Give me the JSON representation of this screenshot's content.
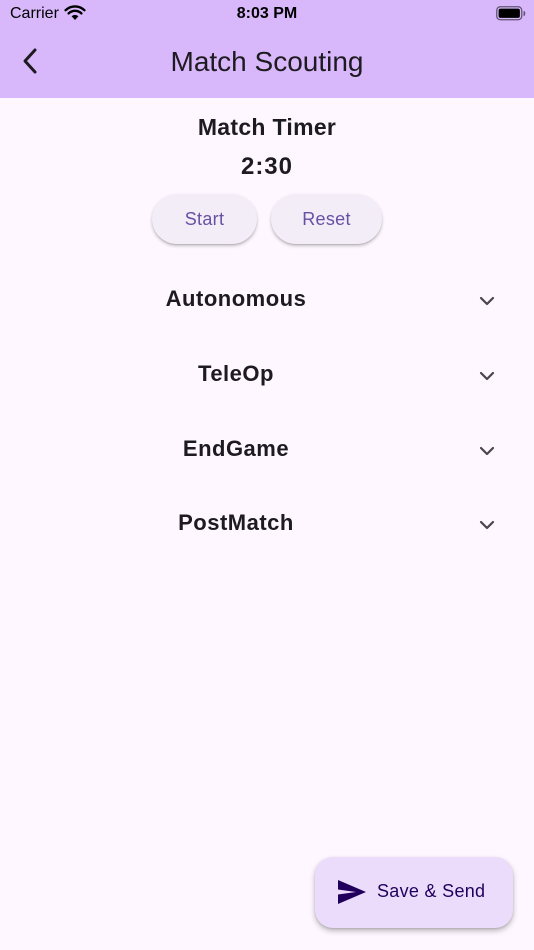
{
  "status_bar": {
    "carrier": "Carrier",
    "time": "8:03 PM",
    "wifi_icon": "wifi-icon",
    "battery_icon": "battery-icon"
  },
  "app_bar": {
    "title": "Match Scouting",
    "back_icon": "chevron-left-icon",
    "background": "#d8b8fb"
  },
  "timer": {
    "label": "Match Timer",
    "value": "2:30",
    "start_label": "Start",
    "reset_label": "Reset"
  },
  "sections": [
    {
      "label": "Autonomous",
      "icon": "chevron-down-icon"
    },
    {
      "label": "TeleOp",
      "icon": "chevron-down-icon"
    },
    {
      "label": "EndGame",
      "icon": "chevron-down-icon"
    },
    {
      "label": "PostMatch",
      "icon": "chevron-down-icon"
    }
  ],
  "fab": {
    "label": "Save & Send",
    "icon": "send-icon",
    "background": "#ecdcfb"
  },
  "colors": {
    "page_background": "#fef7ff",
    "accent": "#6750a4",
    "button_surface": "#f3edf7"
  }
}
